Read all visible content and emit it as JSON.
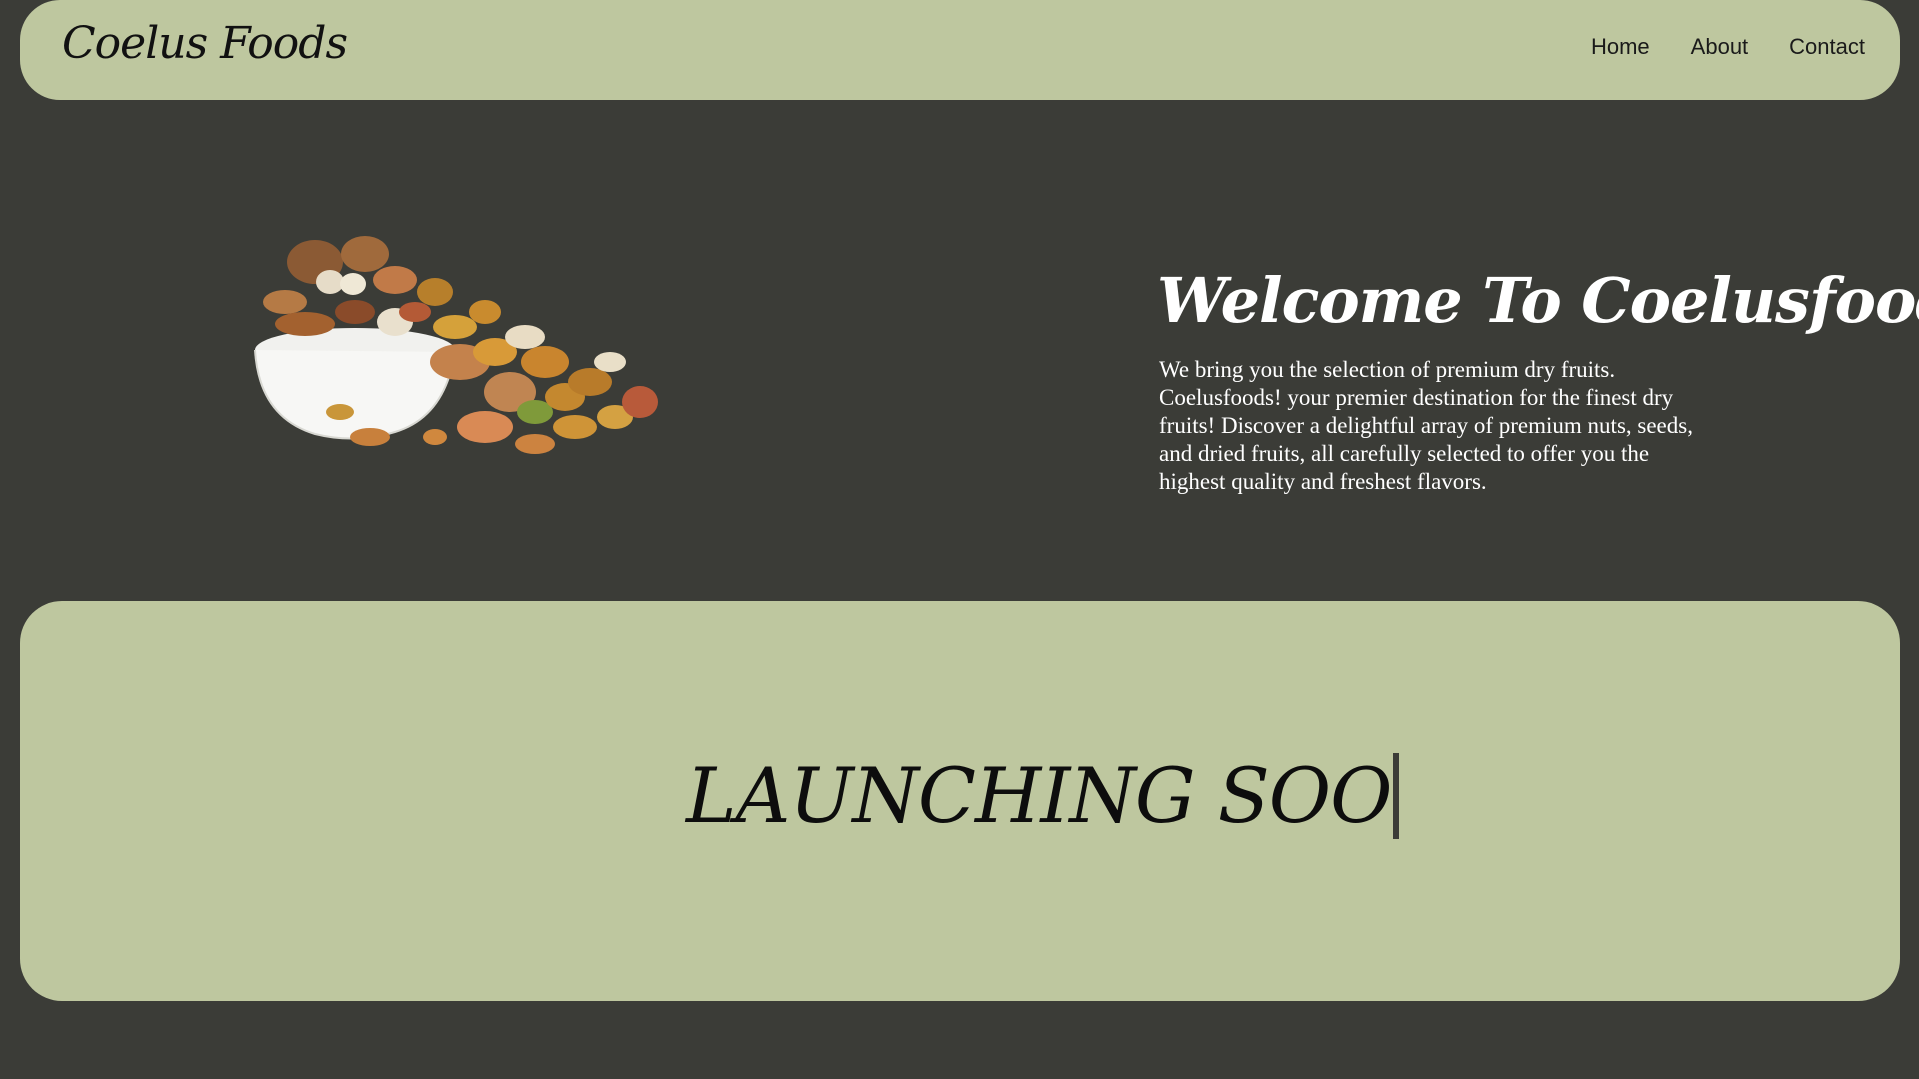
{
  "header": {
    "logo": "Coelus Foods",
    "nav": [
      {
        "label": "Home"
      },
      {
        "label": "About"
      },
      {
        "label": "Contact"
      }
    ]
  },
  "hero": {
    "image_alt": "Bowl of mixed dry fruits and nuts",
    "title": "Welcome To Coelusfoods",
    "description": "We bring you the selection of premium dry fruits. Coelusfoods! your premier destination for the finest dry fruits! Discover a delightful array of premium nuts, seeds, and dried fruits, all carefully selected to offer you the highest quality and freshest flavors."
  },
  "launch": {
    "text": "LAUNCHING SOO"
  },
  "colors": {
    "background": "#3b3c37",
    "panel": "#bec79f",
    "text_light": "#ffffff",
    "text_dark": "#111111"
  }
}
